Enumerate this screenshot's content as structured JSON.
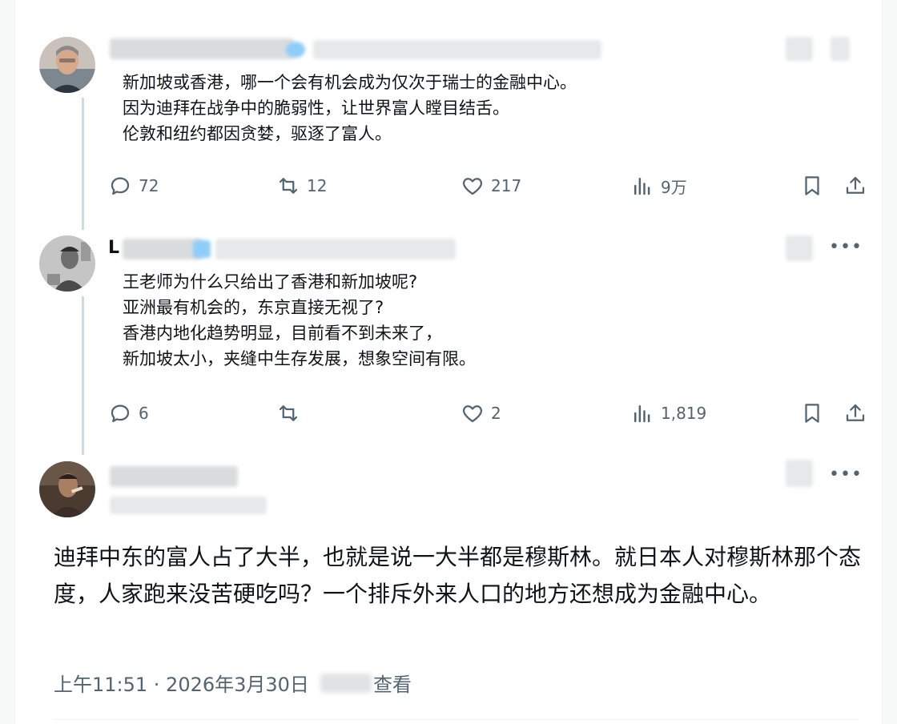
{
  "replies": [
    {
      "name_visible": "",
      "lines": [
        "新加坡或香港，哪一个会有机会成为仅次于瑞士的金融中心。",
        "因为迪拜在战争中的脆弱性，让世界富人瞠目结舌。",
        "伦敦和纽约都因贪婪，驱逐了富人。"
      ],
      "stats": {
        "replies": "72",
        "retweets": "12",
        "likes": "217",
        "views": "9万"
      }
    },
    {
      "name_visible": "L",
      "lines": [
        "王老师为什么只给出了香港和新加坡呢?",
        "亚洲最有机会的，东京直接无视了?",
        "香港内地化趋势明显，目前看不到未来了，",
        "新加坡太小，夹缝中生存发展，想象空间有限。"
      ],
      "stats": {
        "replies": "6",
        "retweets": "",
        "likes": "2",
        "views": "1,819"
      }
    }
  ],
  "main_post": {
    "text": "迪拜中东的富人占了大半，也就是说一大半都是穆斯林。就日本人对穆斯林那个态度，人家跑来没苦硬吃吗？一个排斥外来人口的地方还想成为金融中心。",
    "time": "上午11:51 · 2026年3月30日",
    "views_suffix": "查看",
    "more_label": "•••"
  },
  "icons": [
    "reply-icon",
    "retweet-icon",
    "like-icon",
    "views-icon",
    "bookmark-icon",
    "share-icon",
    "more-icon"
  ],
  "colors": {
    "text": "#0f1419",
    "secondary": "#536471",
    "thread": "#cfd9de",
    "verified": "#1d9bf0"
  }
}
